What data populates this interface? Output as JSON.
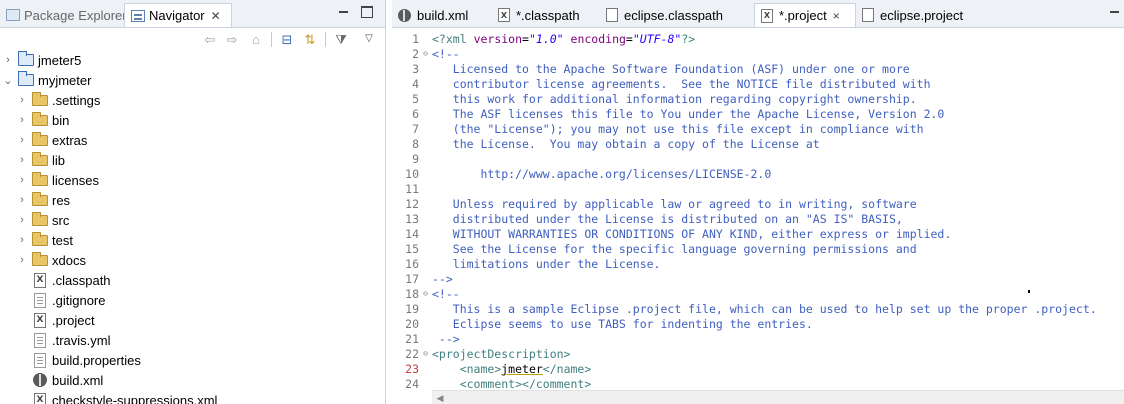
{
  "left_panel": {
    "tabs": [
      {
        "label": "Package Explorer",
        "icon": "package-explorer-icon",
        "active": false
      },
      {
        "label": "Navigator",
        "icon": "navigator-icon",
        "active": true
      }
    ],
    "toolbar_icons": [
      "back-arrow-icon",
      "forward-arrow-icon",
      "home-icon",
      "collapse-all-icon",
      "link-with-editor-icon",
      "filter-icon",
      "view-menu-icon"
    ],
    "tree": [
      {
        "label": "jmeter5",
        "type": "project",
        "expanded": false
      },
      {
        "label": "myjmeter",
        "type": "project",
        "expanded": true
      },
      {
        "label": ".settings",
        "type": "folder"
      },
      {
        "label": "bin",
        "type": "folder"
      },
      {
        "label": "extras",
        "type": "folder"
      },
      {
        "label": "lib",
        "type": "folder"
      },
      {
        "label": "licenses",
        "type": "folder"
      },
      {
        "label": "res",
        "type": "folder"
      },
      {
        "label": "src",
        "type": "folder"
      },
      {
        "label": "test",
        "type": "folder"
      },
      {
        "label": "xdocs",
        "type": "folder"
      },
      {
        "label": ".classpath",
        "type": "xml-file"
      },
      {
        "label": ".gitignore",
        "type": "text-file"
      },
      {
        "label": ".project",
        "type": "xml-file"
      },
      {
        "label": ".travis.yml",
        "type": "text-file"
      },
      {
        "label": "build.properties",
        "type": "text-file"
      },
      {
        "label": "build.xml",
        "type": "ant-file"
      },
      {
        "label": "checkstyle-suppressions.xml",
        "type": "xml-file"
      }
    ]
  },
  "editor": {
    "tabs": [
      {
        "label": "build.xml",
        "icon": "ant-file-icon",
        "active": false
      },
      {
        "label": "*.classpath",
        "icon": "xml-file-icon",
        "active": false
      },
      {
        "label": "eclipse.classpath",
        "icon": "text-file-icon",
        "active": false
      },
      {
        "label": "*.project",
        "icon": "xml-file-icon",
        "active": true,
        "close": "×"
      },
      {
        "label": "eclipse.project",
        "icon": "text-file-icon",
        "active": false
      }
    ],
    "lines": [
      {
        "n": "1",
        "fold": "",
        "parts": [
          [
            "tag",
            "<?"
          ],
          [
            "tag",
            "xml "
          ],
          [
            "attr",
            "version"
          ],
          [
            "c-text",
            "="
          ],
          [
            "val",
            "\"1.0\""
          ],
          [
            "text",
            " "
          ],
          [
            "attr",
            "encoding"
          ],
          [
            "c-text",
            "="
          ],
          [
            "val",
            "\"UTF-8\""
          ],
          [
            "tag",
            "?>"
          ]
        ]
      },
      {
        "n": "2",
        "fold": "⊖",
        "parts": [
          [
            "comment",
            "<!--"
          ]
        ]
      },
      {
        "n": "3",
        "fold": "",
        "parts": [
          [
            "comment",
            "   Licensed to the Apache Software Foundation (ASF) under one or more"
          ]
        ]
      },
      {
        "n": "4",
        "fold": "",
        "parts": [
          [
            "comment",
            "   contributor license agreements.  See the NOTICE file distributed with"
          ]
        ]
      },
      {
        "n": "5",
        "fold": "",
        "parts": [
          [
            "comment",
            "   this work for additional information regarding copyright ownership."
          ]
        ]
      },
      {
        "n": "6",
        "fold": "",
        "parts": [
          [
            "comment",
            "   The ASF licenses this file to You under the Apache License, Version 2.0"
          ]
        ]
      },
      {
        "n": "7",
        "fold": "",
        "parts": [
          [
            "comment",
            "   (the \"License\"); you may not use this file except in compliance with"
          ]
        ]
      },
      {
        "n": "8",
        "fold": "",
        "parts": [
          [
            "comment",
            "   the License.  You may obtain a copy of the License at"
          ]
        ]
      },
      {
        "n": "9",
        "fold": "",
        "parts": []
      },
      {
        "n": "10",
        "fold": "",
        "parts": [
          [
            "comment",
            "       http://www.apache.org/licenses/LICENSE-2.0"
          ]
        ]
      },
      {
        "n": "11",
        "fold": "",
        "parts": []
      },
      {
        "n": "12",
        "fold": "",
        "parts": [
          [
            "comment",
            "   Unless required by applicable law or agreed to in writing, software"
          ]
        ]
      },
      {
        "n": "13",
        "fold": "",
        "parts": [
          [
            "comment",
            "   distributed under the License is distributed on an \"AS IS\" BASIS,"
          ]
        ]
      },
      {
        "n": "14",
        "fold": "",
        "parts": [
          [
            "comment",
            "   WITHOUT WARRANTIES OR CONDITIONS OF ANY KIND, either express or implied."
          ]
        ]
      },
      {
        "n": "15",
        "fold": "",
        "parts": [
          [
            "comment",
            "   See the License for the specific language governing permissions and"
          ]
        ]
      },
      {
        "n": "16",
        "fold": "",
        "parts": [
          [
            "comment",
            "   limitations under the License."
          ]
        ]
      },
      {
        "n": "17",
        "fold": "",
        "parts": [
          [
            "comment",
            "-->"
          ]
        ]
      },
      {
        "n": "18",
        "fold": "⊖",
        "parts": [
          [
            "comment",
            "<!--"
          ]
        ]
      },
      {
        "n": "19",
        "fold": "",
        "parts": [
          [
            "comment",
            "   This is a sample Eclipse .project file, which can be used to help set up the proper .project."
          ]
        ]
      },
      {
        "n": "20",
        "fold": "",
        "parts": [
          [
            "comment",
            "   Eclipse seems to use TABS for indenting the entries."
          ]
        ]
      },
      {
        "n": "21",
        "fold": "",
        "parts": [
          [
            "comment",
            " -->"
          ]
        ]
      },
      {
        "n": "22",
        "fold": "⊖",
        "parts": [
          [
            "tag",
            "<projectDescription>"
          ]
        ]
      },
      {
        "n": "23",
        "fold": "",
        "mod": true,
        "parts": [
          [
            "text",
            "    "
          ],
          [
            "tag",
            "<name>"
          ],
          [
            "textu",
            "jmeter"
          ],
          [
            "tag",
            "</name>"
          ]
        ]
      },
      {
        "n": "24",
        "fold": "",
        "parts": [
          [
            "text",
            "    "
          ],
          [
            "tag",
            "<comment></comment>"
          ]
        ]
      }
    ]
  }
}
